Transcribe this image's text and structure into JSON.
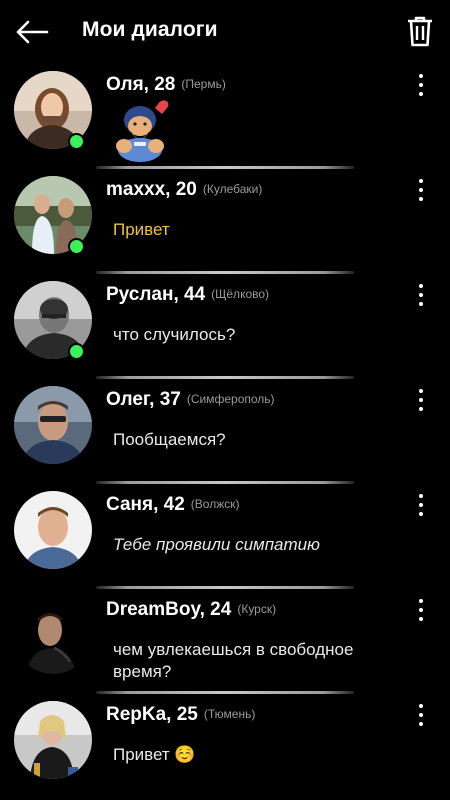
{
  "header": {
    "title": "Мои диалоги",
    "back_icon": "arrow-left-icon",
    "trash_icon": "trash-icon"
  },
  "dialogs": [
    {
      "name": "Оля, 28",
      "city": "(Пермь)",
      "message": "",
      "sticker": "bear-sticker",
      "online": true
    },
    {
      "name": "maxxx, 20",
      "city": "(Кулебаки)",
      "message": "Привет",
      "online": true,
      "message_color": "#f4c22b"
    },
    {
      "name": "Руслан, 44",
      "city": "(Щёлково)",
      "message": "что случилось?",
      "online": true
    },
    {
      "name": "Олег, 37",
      "city": "(Симферополь)",
      "message": "Пообщаемся?",
      "online": false
    },
    {
      "name": "Саня, 42",
      "city": "(Волжск)",
      "message": "Тебе проявили симпатию",
      "online": false
    },
    {
      "name": "DreamBoy, 24",
      "city": "(Курск)",
      "message": "чем увлекаешься в свободное время?",
      "online": false
    },
    {
      "name": "RepKa, 25",
      "city": "(Тюмень)",
      "message": "Привет ☺️",
      "online": false
    }
  ],
  "colors": {
    "background": "#000000",
    "online": "#3cf05a",
    "accent": "#f4c22b"
  }
}
